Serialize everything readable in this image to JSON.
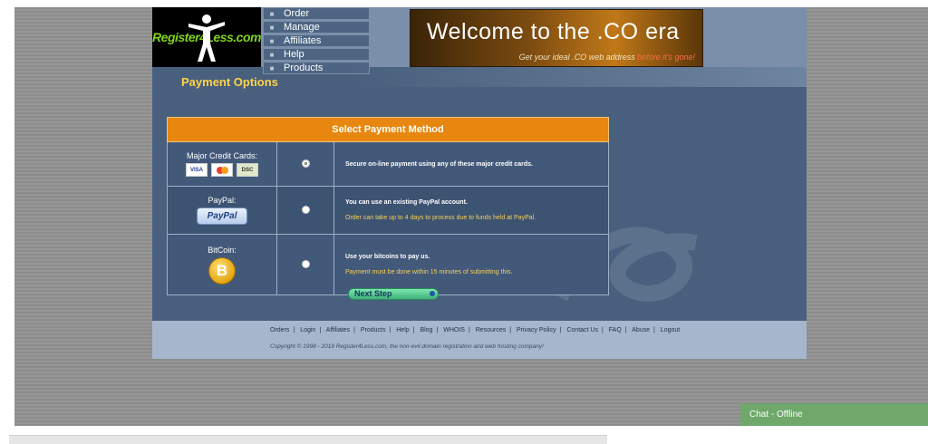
{
  "nav": {
    "items": [
      "Order",
      "Manage",
      "Affiliates",
      "Help",
      "Products"
    ]
  },
  "logo": {
    "text": "Register4Less.com"
  },
  "banner": {
    "title": "Welcome to the .CO era",
    "subtitle_main": "Get your ideal .CO web address",
    "subtitle_accent": "before it's gone!"
  },
  "page": {
    "title": "Payment Options"
  },
  "payment": {
    "header": "Select Payment Method",
    "methods": [
      {
        "name": "Major Credit Cards:",
        "cards": [
          "VISA",
          "MC",
          "DSC"
        ],
        "desc": "Secure on-line payment using any of these major credit cards.",
        "note": "",
        "selected": true
      },
      {
        "name": "PayPal:",
        "logo": "PayPal",
        "desc": "You can use an existing PayPal account.",
        "note": "Order can take up to 4 days to process due to funds held at PayPal.",
        "selected": false
      },
      {
        "name": "BitCoin:",
        "logo": "B",
        "desc": "Use your bitcoins to pay us.",
        "note": "Payment must be done within 15 minutes of submitting this.",
        "selected": false
      }
    ],
    "next_label": "Next Step"
  },
  "footer": {
    "links": [
      "Orders",
      "Login",
      "Affiliates",
      "Products",
      "Help",
      "Blog",
      "WHOIS",
      "Resources",
      "Privacy Policy",
      "Contact Us",
      "FAQ",
      "Abuse",
      "Logout"
    ],
    "copyright": "Copyright © 1998 - 2019 Register4Less.com, the non-evil domain registration and web hosting company!"
  },
  "chat": {
    "label": "Chat - Offline"
  },
  "colors": {
    "accent_orange": "#e7870f",
    "title_yellow": "#ffd24a",
    "page_bg": "#48607d",
    "chat_green": "#6fa86a"
  }
}
